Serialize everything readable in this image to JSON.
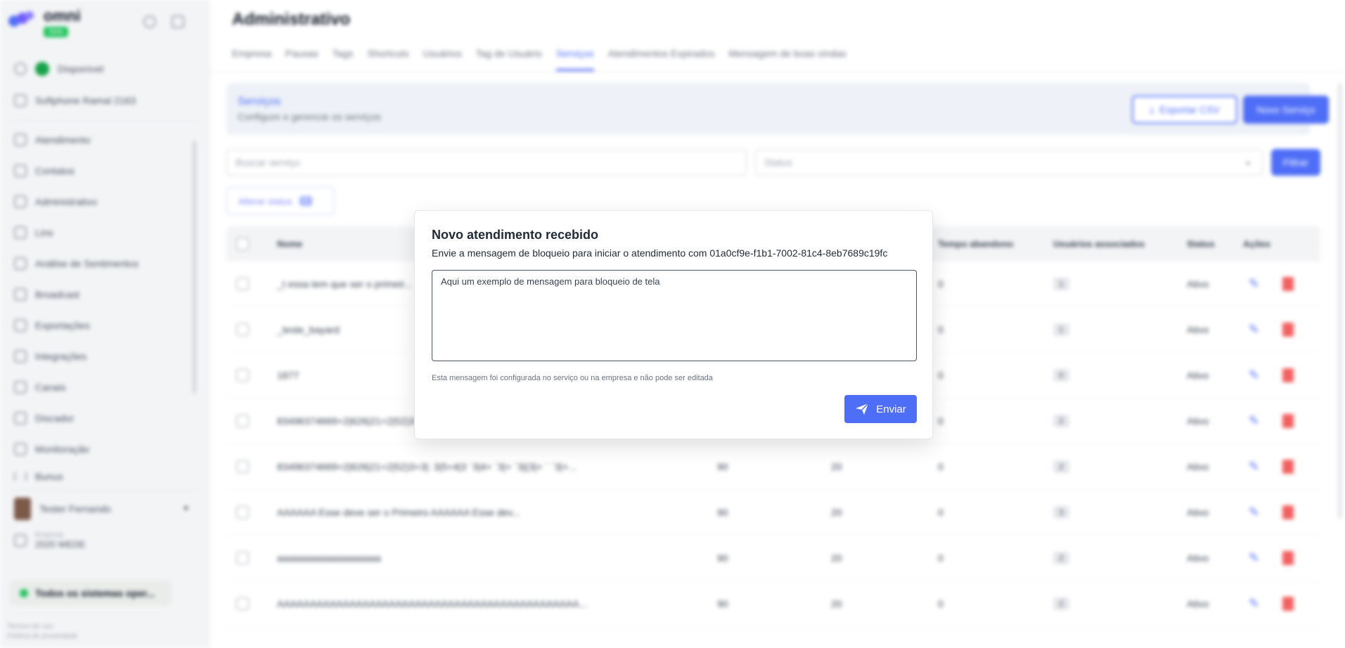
{
  "sidebar": {
    "brand": "omni",
    "brand_badge": "beta",
    "status": "Disponível",
    "softphone": "Softphone Ramal 2163",
    "items": [
      "Atendimento",
      "Contatos",
      "Administrativo",
      "Lins",
      "Análise de Sentimentos",
      "Broadcast",
      "Exportações",
      "Integrações",
      "Canais",
      "Discador",
      "Monitoração",
      "Bunus"
    ],
    "user_name": "Tester Fernando",
    "company_label": "Empresa",
    "company_value": "2020 WEDE",
    "systems": "Todos os sistemas oper...",
    "foot1": "Termos de uso",
    "foot2": "Política de privacidade"
  },
  "main": {
    "title": "Administrativo",
    "tabs": [
      "Empresa",
      "Pausas",
      "Tags",
      "Shortcuts",
      "Usuários",
      "Tag de Usuário",
      "Serviços",
      "Atendimentos Expirados",
      "Mensagem de boas vindas"
    ],
    "card_title": "Serviços",
    "card_subtitle": "Configure e gerencie os serviços",
    "export_label": "Exportar CSV",
    "new_label": "Novo Serviço",
    "search_placeholder": "Buscar serviço",
    "status_placeholder": "Status",
    "filter_label": "Filtrar",
    "status_button": "Alterar status",
    "status_count": "0",
    "headers": {
      "name": "Nome",
      "abandon": "Tempo abandono",
      "users": "Usuários associados",
      "status": "Status",
      "actions": "Ações"
    },
    "rows": [
      {
        "name": "_t essa tem que ser o primeir...",
        "c1": "",
        "c2": "",
        "abandon": "0",
        "users": "1",
        "status": "Ativo"
      },
      {
        "name": "_teste_bayard",
        "c1": "",
        "c2": "",
        "abandon": "0",
        "users": "1",
        "status": "Ativo"
      },
      {
        "name": "1877",
        "c1": "",
        "c2": "",
        "abandon": "0",
        "users": "0",
        "status": "Ativo"
      },
      {
        "name": "83496374669+2|626|21+2|52)3+...",
        "c1": "",
        "c2": "",
        "abandon": "0",
        "users": "2",
        "status": "Ativo"
      },
      {
        "name": "83496374669+2|626|21+2|52)3+3|: 3|5+4|3 `3|4+ `3|+ `3|(3|+ ` `3|+...",
        "c1": "90",
        "c2": "20",
        "abandon": "0",
        "users": "2",
        "status": "Ativo"
      },
      {
        "name": "AAAAAA Esse deve ser o Primeiro AAAAAA Esse dev...",
        "c1": "90",
        "c2": "20",
        "abandon": "0",
        "users": "3",
        "status": "Ativo"
      },
      {
        "name": "aaaaaaaaaaaaaaaaaaa",
        "c1": "90",
        "c2": "20",
        "abandon": "0",
        "users": "2",
        "status": "Ativo"
      },
      {
        "name": "AAAAAAAAAAAAAAAAAAAAAAAAAAAAAAAAAAAAAAAAAAAAAA...",
        "c1": "90",
        "c2": "20",
        "abandon": "0",
        "users": "2",
        "status": "Ativo"
      }
    ]
  },
  "modal": {
    "title": "Novo atendimento recebido",
    "description": "Envie a mensagem de bloqueio para iniciar o atendimento com 01a0cf9e-f1b1-7002-81c4-8eb7689c19fc",
    "message": "Aqui um exemplo de mensagem para bloqueio de tela",
    "hint": "Esta mensagem foi configurada no serviço ou na empresa e não pode ser editada",
    "send_label": "Enviar"
  },
  "colors": {
    "accent": "#4f6ef7",
    "danger": "#ef4444",
    "online": "#16a34a"
  }
}
